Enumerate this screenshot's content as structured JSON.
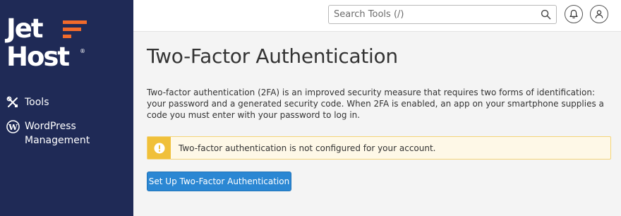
{
  "brand": {
    "logo_line1": "Jet",
    "logo_line2": "Host",
    "logo_reg": "®",
    "accent_color": "#f26b2b",
    "sidebar_color": "#1f2a56"
  },
  "sidebar": {
    "items": [
      {
        "label": "Tools",
        "icon": "tools-icon"
      },
      {
        "label": "WordPress Management",
        "icon": "wordpress-icon"
      }
    ]
  },
  "header": {
    "search": {
      "placeholder": "Search Tools (/)",
      "value": ""
    },
    "notifications_icon": "bell-icon",
    "user_icon": "user-icon"
  },
  "main": {
    "title": "Two-Factor Authentication",
    "description": "Two-factor authentication (2FA) is an improved security measure that requires two forms of identification: your password and a generated security code. When 2FA is enabled, an app on your smartphone supplies a code you must enter with your password to log in.",
    "alert": {
      "icon": "warning-icon",
      "text": "Two-factor authentication is not configured for your account.",
      "color": "#f0c03a"
    },
    "setup_button": {
      "label": "Set Up Two-Factor Authentication",
      "color": "#2b87d3"
    }
  }
}
